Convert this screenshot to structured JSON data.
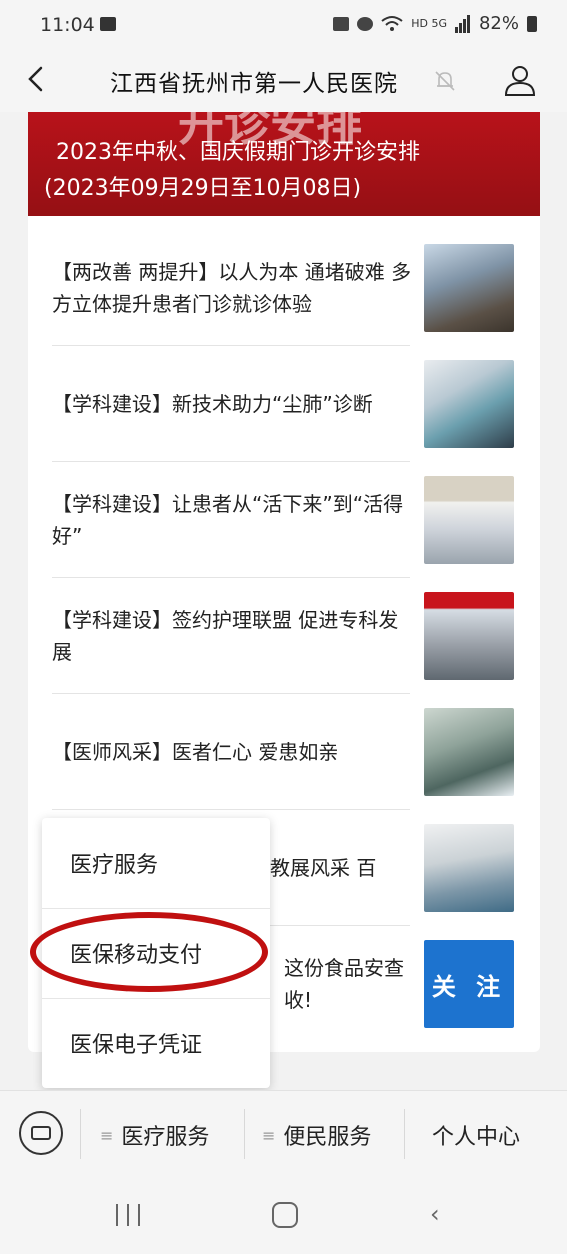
{
  "status_bar": {
    "time": "11:04",
    "network": "HD 5G",
    "battery": "82%"
  },
  "header": {
    "title": "江西省抚州市第一人民医院"
  },
  "banner": {
    "ghost_text": "开诊安排",
    "line1": "2023年中秋、国庆假期门诊开诊安排",
    "line2": "(2023年09月29日至10月08日)"
  },
  "news": [
    {
      "title": "【两改善 两提升】以人为本 通堵破难 多方立体提升患者门诊就诊体验"
    },
    {
      "title": "【学科建设】新技术助力“尘肺”诊断"
    },
    {
      "title": "【学科建设】让患者从“活下来”到“活得好”"
    },
    {
      "title": "【学科建设】签约护理联盟 促进专科发展"
    },
    {
      "title": "【医师风采】医者仁心 爱患如亲"
    },
    {
      "title": "教展风采 百"
    },
    {
      "title": "这份食品安查收!",
      "thumb_label": "关 注"
    }
  ],
  "popup_menu": {
    "items": [
      "医疗服务",
      "医保移动支付",
      "医保电子凭证"
    ]
  },
  "bottom_menu": {
    "tab1": "医疗服务",
    "tab2": "便民服务",
    "tab3": "个人中心"
  },
  "colors": {
    "banner_red": "#b8121a",
    "highlight_ring": "#c01010",
    "follow_blue": "#1d73cf"
  }
}
